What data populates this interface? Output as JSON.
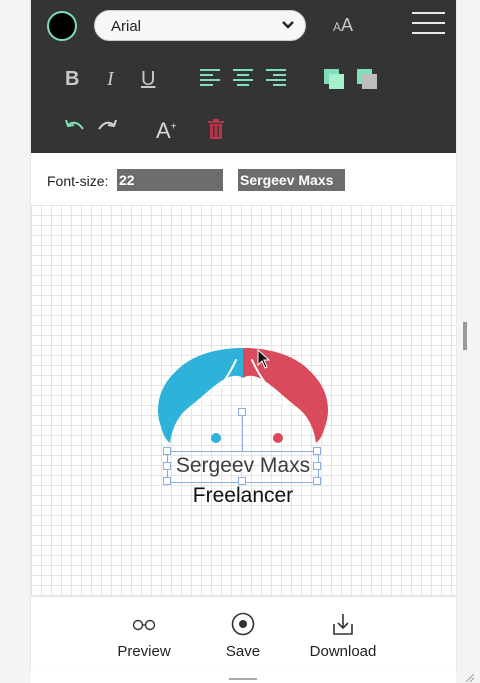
{
  "toolbar": {
    "text_color": "#000000",
    "accent_color": "#7fe0b8",
    "font_family_value": "Arial",
    "font_size_small_glyph": "A",
    "font_size_large_glyph": "A",
    "bold_label": "B",
    "italic_label": "I",
    "underline_label": "U",
    "add_text_label": "A",
    "add_text_sup": "+"
  },
  "info_row": {
    "font_size_label": "Font-size:",
    "font_size_value": "22",
    "text_value": "Sergeev Maxs"
  },
  "canvas": {
    "logo_name": "Sergeev Maxs",
    "logo_tagline": "Freelancer",
    "left_color": "#2eb2d9",
    "right_color": "#d84a5c"
  },
  "bottombar": {
    "preview_label": "Preview",
    "save_label": "Save",
    "download_label": "Download"
  }
}
